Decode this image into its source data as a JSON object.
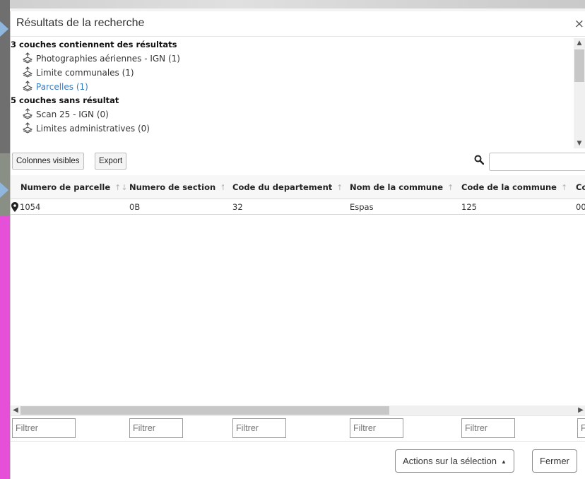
{
  "dialog": {
    "title": "Résultats de la recherche",
    "close_label": "×"
  },
  "layers": {
    "with_results_title": "3 couches contiennent des résultats",
    "with_results": [
      {
        "label": "Photographies aériennes - IGN (1)"
      },
      {
        "label": "Limite communales (1)"
      },
      {
        "label": "Parcelles (1)"
      }
    ],
    "without_results_title": "5 couches sans résultat",
    "without_results": [
      {
        "label": "Scan 25 - IGN (0)"
      },
      {
        "label": "Limites administratives (0)"
      }
    ]
  },
  "toolbar": {
    "visible_columns_label": "Colonnes visibles",
    "export_label": "Export",
    "search_value": ""
  },
  "table": {
    "columns": [
      "Numero de parcelle",
      "Numero de section",
      "Code du departement",
      "Nom de la commune",
      "Code de la commune",
      "Code"
    ],
    "sort_glyph": "↑↓",
    "rows": [
      [
        "1054",
        "0B",
        "32",
        "Espas",
        "125",
        "00"
      ]
    ]
  },
  "filters": {
    "placeholder": "Filtrer"
  },
  "footer": {
    "actions_label": "Actions sur la sélection",
    "actions_caret": "▲",
    "close_label": "Fermer"
  },
  "colors": {
    "link": "#3a7bbf",
    "map_pink": "#e64fd8",
    "map_arrow": "#8fb7dd"
  }
}
